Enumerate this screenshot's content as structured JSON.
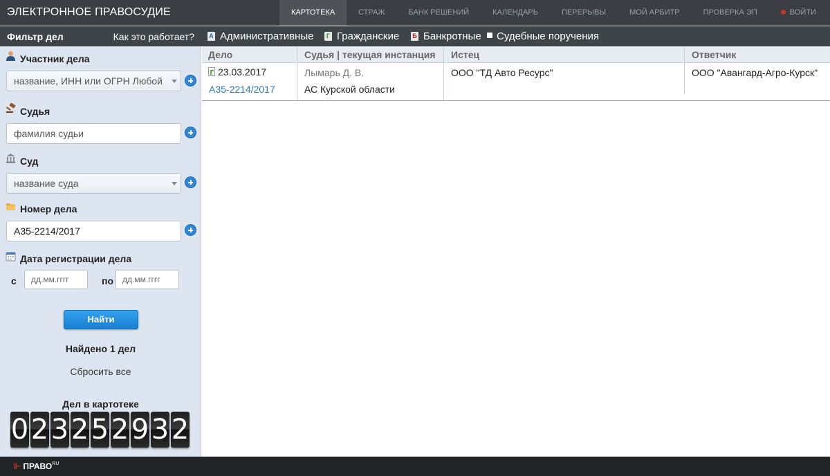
{
  "header": {
    "brand": "ЭЛЕКТРОННОЕ ПРАВОСУДИЕ",
    "nav": [
      {
        "label": "КАРТОТЕКА",
        "active": true
      },
      {
        "label": "СТРАЖ",
        "active": false
      },
      {
        "label": "БАНК РЕШЕНИЙ",
        "active": false
      },
      {
        "label": "КАЛЕНДАРЬ",
        "active": false
      },
      {
        "label": "ПЕРЕРЫВЫ",
        "active": false
      },
      {
        "label": "МОЙ АРБИТР",
        "active": false
      },
      {
        "label": "ПРОВЕРКА ЭП",
        "active": false
      }
    ],
    "logout": "ВОЙТИ"
  },
  "sidebar": {
    "title": "Фильтр дел",
    "help": "Как это работает?",
    "participant": {
      "label": "Участник дела",
      "placeholder": "название, ИНН или ОГРН",
      "role": "Любой"
    },
    "judge": {
      "label": "Судья",
      "placeholder": "фамилия судьи"
    },
    "court": {
      "label": "Суд",
      "placeholder": "название суда"
    },
    "case_number": {
      "label": "Номер дела",
      "value": "А35-2214/2017"
    },
    "reg_date": {
      "label": "Дата регистрации дела",
      "from_label": "с",
      "to_label": "по",
      "from_placeholder": "дд.мм.гггг",
      "to_placeholder": "дд.мм.гггг"
    },
    "find_button": "Найти",
    "found": "Найдено 1 дел",
    "reset": "Сбросить все",
    "counter_title": "Дел в картотеке",
    "counter_digits": [
      "0",
      "2",
      "3",
      "2",
      "5",
      "2",
      "9",
      "3",
      "2"
    ]
  },
  "categories": [
    {
      "icon_letter": "А",
      "label": "Административные"
    },
    {
      "icon_letter": "Г",
      "label": "Гражданские"
    },
    {
      "icon_letter": "Б",
      "label": "Банкротные"
    },
    {
      "icon_letter": "",
      "label": "Судебные поручения"
    }
  ],
  "table": {
    "columns": [
      "Дело",
      "Судья | текущая инстанция",
      "Истец",
      "Ответчик"
    ],
    "rows": [
      {
        "date": "23.03.2017",
        "case_no": "А35-2214/2017",
        "judge": "Лымарь Д. В.",
        "court": "АС Курской области",
        "plaintiff": "ООО \"ТД Авто Ресурс\"",
        "defendant": "ООО \"Авангард-Агро-Курск\""
      }
    ]
  },
  "footer": {
    "logo": "ПРАВО",
    "logo_suffix": "RU"
  },
  "colors": {
    "accent": "#2f86d4",
    "link": "#2a7ab8",
    "topbar": "#3b3f44",
    "sidebar": "#dde6f0"
  }
}
